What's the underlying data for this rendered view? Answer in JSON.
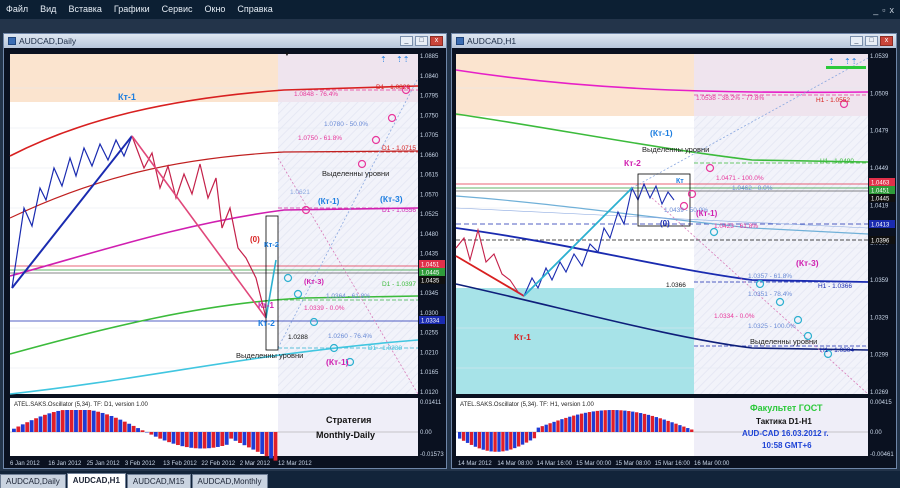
{
  "menu": [
    "Файл",
    "Вид",
    "Вставка",
    "Графики",
    "Сервис",
    "Окно",
    "Справка"
  ],
  "window_buttons": [
    "_",
    "▫",
    "x"
  ],
  "left_window": {
    "title": "AUDCAD,Daily",
    "price_scale": [
      "1.0885",
      "1.0840",
      "1.0795",
      "1.0750",
      "1.0705",
      "1.0660",
      "1.0615",
      "1.0570",
      "1.0525",
      "1.0480",
      "1.0435",
      "1.0390",
      "1.0345",
      "1.0300",
      "1.0255",
      "1.0210",
      "1.0165",
      "1.0120"
    ],
    "price_tags": [
      "1.0451",
      "1.0445",
      "1.0435",
      "1.0334"
    ],
    "date_axis": [
      "6 Jan 2012",
      "16 Jan 2012",
      "25 Jan 2012",
      "3 Feb 2012",
      "13 Feb 2012",
      "22 Feb 2012",
      "2 Mar 2012",
      "12 Mar 2012"
    ],
    "level_labels": [
      "1.0848 - 76.4%",
      "D1 - 1.0826",
      "1.0780 - 50.0%",
      "1.0750 - 61.8%",
      "D1 - 1.0715",
      "1.0621",
      "D1 - 1.0556",
      "D1 - 1.0397",
      "1.0364 - 61.8%",
      "1.0339 - 0.0%",
      "1.0288",
      "1.0260 - 76.4%",
      "D1 - 1.0238"
    ],
    "annotations": {
      "kt1_top": "Кт-1",
      "vydel_top": "Выделенны уровни",
      "kt1_mid": "(Кт-1)",
      "kt3": "(Кт-3)",
      "zero": "(0)",
      "kt2_small": "Кт-2",
      "kt3_low": "(Кт-3)",
      "kt1_low": "Кт-1",
      "kt2_low": "Кт-2",
      "vydel_bottom": "Выделенны уровни",
      "kt1_bottom": "(Кт-1)"
    },
    "oscillator": {
      "label": "ATEL.SAKS.Oscillator (5,34). TF: D1, version 1.00",
      "scale": [
        "0.01411",
        "0.00",
        "-0.01573"
      ],
      "strategy_line1": "Стратегия",
      "strategy_line2": "Monthly-Daily"
    }
  },
  "right_window": {
    "title": "AUDCAD,H1",
    "price_scale": [
      "1.0539",
      "1.0509",
      "1.0479",
      "1.0449",
      "1.0419",
      "1.0389",
      "1.0359",
      "1.0329",
      "1.0299",
      "1.0269"
    ],
    "price_tags": [
      "1.0463",
      "1.0451",
      "1.0445",
      "1.0413",
      "1.0396"
    ],
    "date_axis": [
      "14 Mar 2012",
      "14 Mar 08:00",
      "14 Mar 16:00",
      "15 Mar 00:00",
      "15 Mar 08:00",
      "15 Mar 16:00",
      "16 Mar 00:00"
    ],
    "level_labels": [
      "1.0538 - 38.2% - 77.8%",
      "H1 - 1.0552",
      "H1 - 1.0490",
      "1.0471 - 100.0%",
      "1.0462 - 0.0%",
      "1.0439 - 50.0%",
      "1.0423 - 61.8%",
      "1.0366",
      "1.0357 - 61.8%",
      "1.0351 - 78.4%",
      "H1 - 1.0366",
      "1.0334 - 0.0%",
      "1.0325 - 100.0%",
      "H1 - 1.0304"
    ],
    "annotations": {
      "kt1_top": "(Кт-1)",
      "vydel_top": "Выделенны уровни",
      "kt2": "Кт-2",
      "kt2_small": "Кт",
      "zero": "(0)",
      "kt1_right": "(Кт-1)",
      "kt3": "(Кт-3)",
      "kt1_bottom": "Кт-1",
      "vydel_bottom": "Выделенны уровни"
    },
    "oscillator": {
      "label": "ATEL.SAKS.Oscillator (5,34). TF: H1, version 1.00",
      "scale": [
        "0.00415",
        "0.00",
        "-0.00461"
      ],
      "info_title": "Факультет ГОСТ",
      "info_line2": "Тактика  D1-H1",
      "info_line3": "AUD-CAD 16.03.2012 г.",
      "info_line4": "10:58  GMT+6"
    }
  },
  "tabs": [
    "AUDCAD,Daily",
    "AUDCAD,H1",
    "AUDCAD,M15",
    "AUDCAD,Monthly"
  ],
  "active_tab": "AUDCAD,H1",
  "colors": {
    "background": "#0a1120",
    "chart_bg": "#ffffff",
    "bull_bar": "#1f3bd6",
    "bear_bar": "#e01f2a",
    "label_pink": "#e8379b",
    "label_blue": "#1d7ee0",
    "info_green": "#2bc93a",
    "info_blue": "#1f44d6"
  }
}
